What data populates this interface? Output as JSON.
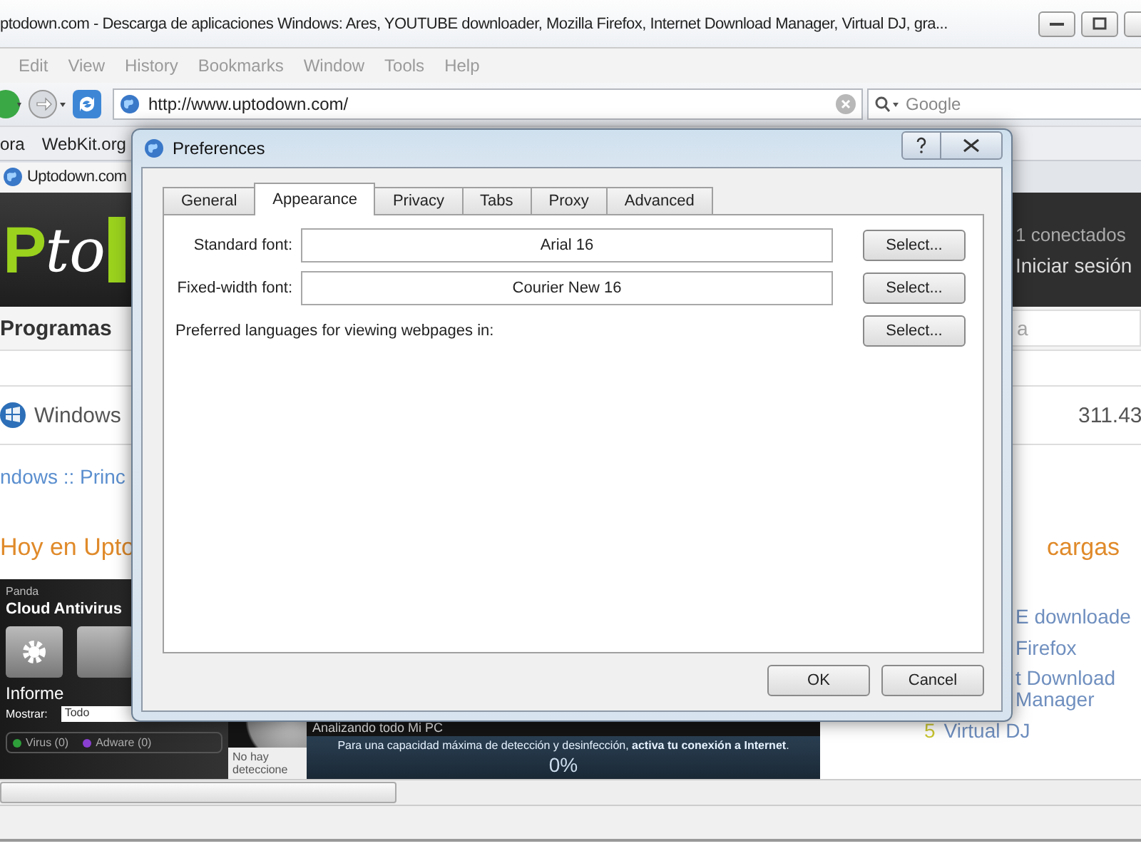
{
  "browser": {
    "title": "ptodown.com - Descarga de aplicaciones Windows: Ares, YOUTUBE downloader, Mozilla Firefox, Internet Download Manager, Virtual DJ, gra...",
    "menu": [
      "Edit",
      "View",
      "History",
      "Bookmarks",
      "Window",
      "Tools",
      "Help"
    ],
    "address": "http://www.uptodown.com/",
    "search": {
      "placeholder": "Google"
    },
    "bookmarks": [
      "ora",
      "WebKit.org"
    ],
    "tabs": [
      {
        "label": "Uptodown.com"
      }
    ]
  },
  "page": {
    "logo": [
      "P",
      "to"
    ],
    "online": "1 conectados",
    "login": "Iniciar sesión",
    "nav": "Programas",
    "search_value": "a",
    "section": "Windows",
    "count": "311.43",
    "breadcrumb": "ndows :: Princ",
    "today_heading": "Hoy en Upto",
    "downloads_heading": "cargas",
    "top_downloads": [
      {
        "name": "E downloade"
      },
      {
        "name": "Firefox"
      },
      {
        "name": "t Download Manager"
      },
      {
        "rank": "5",
        "name": "Virtual DJ"
      }
    ],
    "antivirus": {
      "brand": "Panda",
      "product": "Cloud Antivirus",
      "report": "Informe",
      "show_label": "Mostrar:",
      "show_value": "Todo",
      "legend": [
        {
          "label": "Virus (0)",
          "color": "#2e9e3a"
        },
        {
          "label": "Adware (0)",
          "color": "#8a3fd1"
        }
      ],
      "no_detections": "No hay deteccione",
      "scan_title": "Analizando todo Mi PC",
      "scan_note": "Para una capacidad máxima de detección y desinfección, **activa tu conexión a Internet**.",
      "progress": "0%"
    }
  },
  "dialog": {
    "title": "Preferences",
    "tabs": [
      {
        "label": "General",
        "selected": false
      },
      {
        "label": "Appearance",
        "selected": true
      },
      {
        "label": "Privacy",
        "selected": false
      },
      {
        "label": "Tabs",
        "selected": false
      },
      {
        "label": "Proxy",
        "selected": false
      },
      {
        "label": "Advanced",
        "selected": false
      }
    ],
    "rows": [
      {
        "label": "Standard font:",
        "value": "Arial 16",
        "button": "Select..."
      },
      {
        "label": "Fixed-width font:",
        "value": "Courier New 16",
        "button": "Select..."
      },
      {
        "label": "Preferred languages for viewing webpages in:",
        "button": "Select..."
      }
    ],
    "buttons": [
      "OK",
      "Cancel"
    ]
  }
}
